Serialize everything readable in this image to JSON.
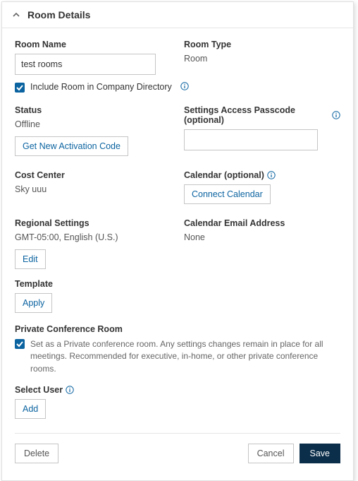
{
  "header": {
    "title": "Room Details"
  },
  "roomName": {
    "label": "Room Name",
    "value": "test rooms"
  },
  "roomType": {
    "label": "Room Type",
    "value": "Room"
  },
  "directory": {
    "label": "Include Room in Company Directory"
  },
  "status": {
    "label": "Status",
    "value": "Offline",
    "button": "Get New Activation Code"
  },
  "passcode": {
    "label": "Settings Access Passcode (optional)",
    "value": ""
  },
  "costCenter": {
    "label": "Cost Center",
    "value": "Sky uuu"
  },
  "calendar": {
    "label": "Calendar (optional)",
    "button": "Connect Calendar"
  },
  "regional": {
    "label": "Regional Settings",
    "value": "GMT-05:00, English (U.S.)",
    "button": "Edit"
  },
  "calendarEmail": {
    "label": "Calendar Email Address",
    "value": "None"
  },
  "template": {
    "label": "Template",
    "button": "Apply"
  },
  "privateRoom": {
    "label": "Private Conference Room",
    "desc": "Set as a Private conference room. Any settings changes remain in place for all meetings. Recommended for executive, in-home, or other private conference rooms."
  },
  "selectUser": {
    "label": "Select User",
    "button": "Add"
  },
  "footer": {
    "delete": "Delete",
    "cancel": "Cancel",
    "save": "Save"
  }
}
